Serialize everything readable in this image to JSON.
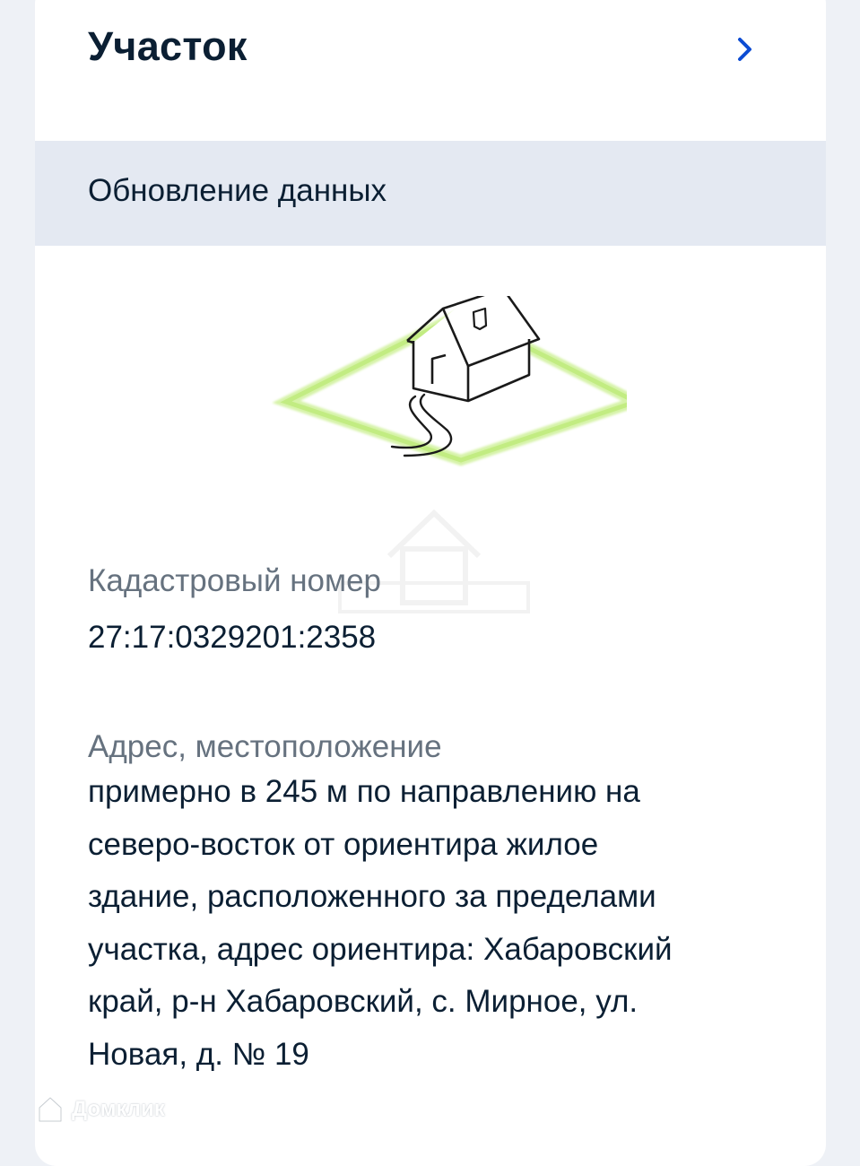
{
  "card": {
    "title": "Участок",
    "chevron_icon": "chevron-right-icon",
    "accent_color": "#0d4cd3"
  },
  "update_banner": {
    "text": "Обновление данных"
  },
  "illustration": {
    "icon": "house-plot-icon",
    "plot_color": "#c9ef8f"
  },
  "fields": {
    "cadastral": {
      "label": "Кадастровый номер",
      "value": "27:17:0329201:2358"
    },
    "address": {
      "label": "Адрес, местоположение",
      "lines": [
        "примерно в 245 м по направлению на",
        "северо-восток от ориентира жилое",
        "здание, расположенного за пределами",
        "участка, адрес ориентира: Хабаровский",
        "край, р-н Хабаровский, с. Мирное, ул.",
        "Новая, д. № 19"
      ]
    }
  },
  "watermarks": {
    "domclick": "Домклик",
    "domclick_icon": "domclick-logo-icon"
  }
}
